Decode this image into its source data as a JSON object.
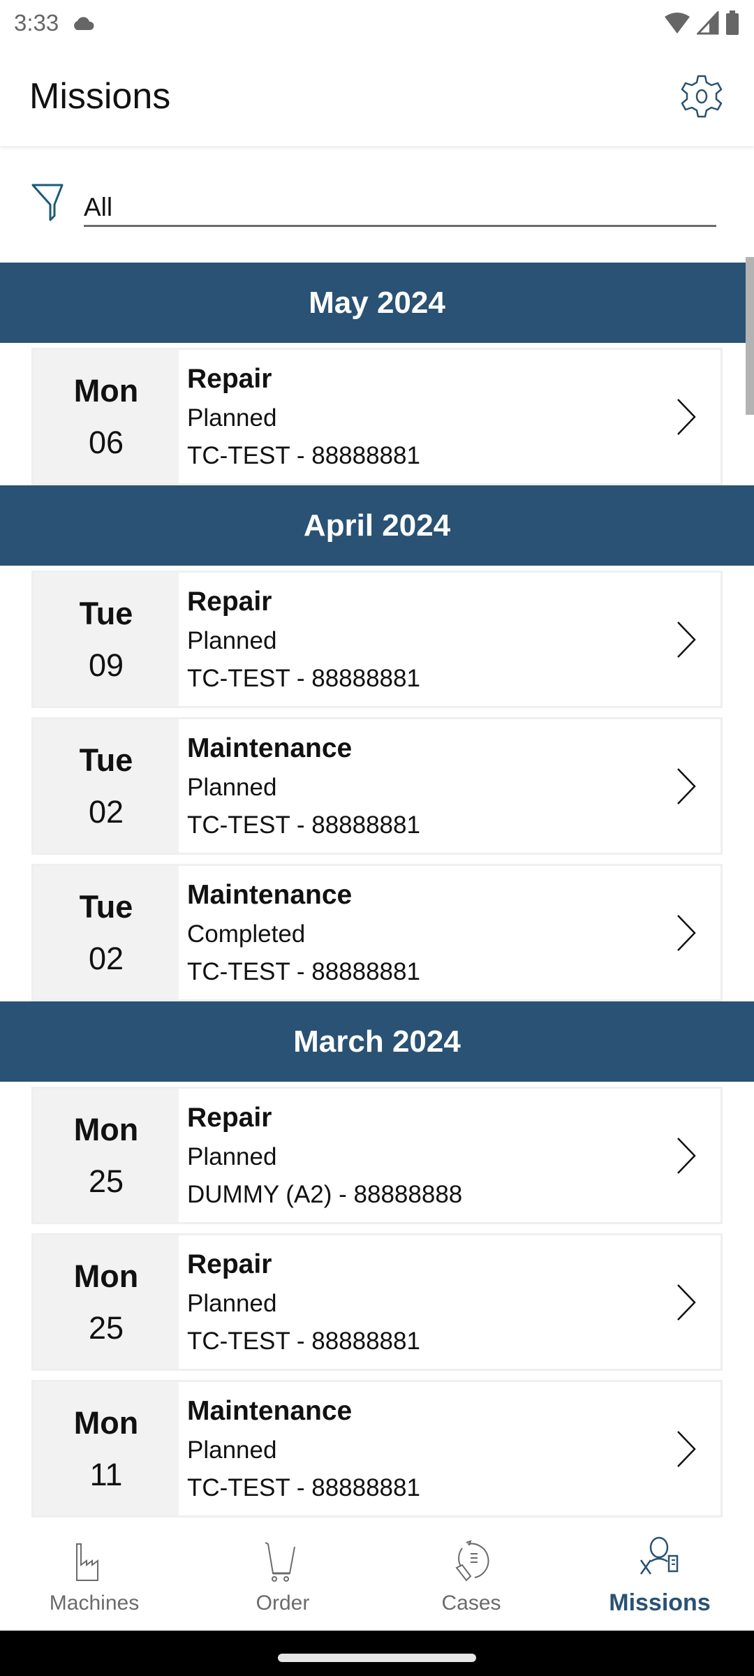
{
  "status_bar": {
    "time": "3:33",
    "icons": [
      "cloud-icon",
      "wifi-icon",
      "signal-icon",
      "battery-icon"
    ]
  },
  "app_bar": {
    "title": "Missions",
    "settings_icon": "gear-icon"
  },
  "filter": {
    "icon": "filter-icon",
    "value": "All"
  },
  "colors": {
    "accent": "#295274",
    "date_block_bg": "#f2f2f2",
    "inactive_nav": "#6b6b6b"
  },
  "sections": [
    {
      "month": "May 2024",
      "missions": [
        {
          "dow": "Mon",
          "day": "06",
          "type": "Repair",
          "status": "Planned",
          "machine": "TC-TEST - 88888881"
        }
      ]
    },
    {
      "month": "April 2024",
      "missions": [
        {
          "dow": "Tue",
          "day": "09",
          "type": "Repair",
          "status": "Planned",
          "machine": "TC-TEST - 88888881"
        },
        {
          "dow": "Tue",
          "day": "02",
          "type": "Maintenance",
          "status": "Planned",
          "machine": "TC-TEST - 88888881"
        },
        {
          "dow": "Tue",
          "day": "02",
          "type": "Maintenance",
          "status": "Completed",
          "machine": "TC-TEST - 88888881"
        }
      ]
    },
    {
      "month": "March 2024",
      "missions": [
        {
          "dow": "Mon",
          "day": "25",
          "type": "Repair",
          "status": "Planned",
          "machine": "DUMMY (A2) - 88888888"
        },
        {
          "dow": "Mon",
          "day": "25",
          "type": "Repair",
          "status": "Planned",
          "machine": "TC-TEST - 88888881"
        },
        {
          "dow": "Mon",
          "day": "11",
          "type": "Maintenance",
          "status": "Planned",
          "machine": "TC-TEST - 88888881"
        }
      ]
    }
  ],
  "bottom_nav": [
    {
      "label": "Machines",
      "icon": "factory-icon",
      "active": false
    },
    {
      "label": "Order",
      "icon": "cart-icon",
      "active": false
    },
    {
      "label": "Cases",
      "icon": "cases-icon",
      "active": false
    },
    {
      "label": "Missions",
      "icon": "missions-icon",
      "active": true
    }
  ]
}
